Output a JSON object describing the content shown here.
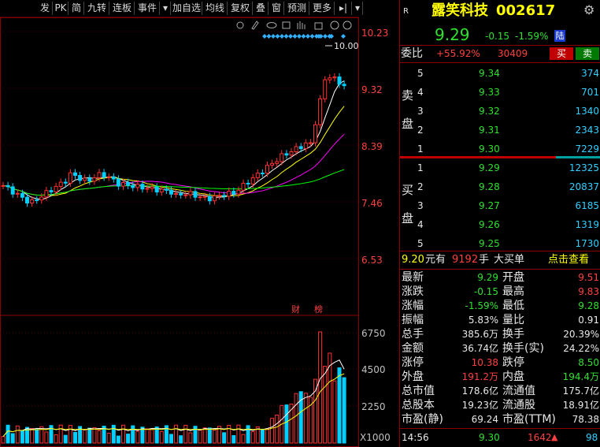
{
  "toolbar": {
    "items": [
      "发",
      "PK",
      "简",
      "九转",
      "连板",
      "事件",
      "▾",
      "加自选",
      "均线",
      "复权",
      "叠",
      "窗",
      "预测",
      "更多",
      "▸|",
      "▾"
    ]
  },
  "chart": {
    "price_ticks": [
      "10.23",
      "9.32",
      "8.39",
      "7.46",
      "6.53"
    ],
    "volume_ticks": [
      "6750",
      "4500",
      "2250"
    ],
    "volume_unit": "X1000",
    "high_label": "10.00",
    "event_tags": [
      "财",
      "榜"
    ]
  },
  "stock": {
    "market_badge": "R",
    "name": "露笑科技",
    "code": "002617",
    "price": "9.29",
    "change": "-0.15",
    "change_pct": "-1.59%",
    "exchange_badge": "陆"
  },
  "weibi": {
    "label": "委比",
    "pct": "+55.92%",
    "diff": "30409",
    "buy_btn": "买",
    "sell_btn": "卖"
  },
  "sell_label": [
    "卖",
    "盘"
  ],
  "buy_label": [
    "买",
    "盘"
  ],
  "sell_orders": [
    {
      "lvl": "5",
      "price": "9.34",
      "vol": "374"
    },
    {
      "lvl": "4",
      "price": "9.33",
      "vol": "701"
    },
    {
      "lvl": "3",
      "price": "9.32",
      "vol": "1340"
    },
    {
      "lvl": "2",
      "price": "9.31",
      "vol": "2343"
    },
    {
      "lvl": "1",
      "price": "9.30",
      "vol": "7229"
    }
  ],
  "buy_orders": [
    {
      "lvl": "1",
      "price": "9.29",
      "vol": "12325"
    },
    {
      "lvl": "2",
      "price": "9.28",
      "vol": "20837"
    },
    {
      "lvl": "3",
      "price": "9.27",
      "vol": "6185"
    },
    {
      "lvl": "4",
      "price": "9.26",
      "vol": "1319"
    },
    {
      "lvl": "5",
      "price": "9.25",
      "vol": "1730"
    }
  ],
  "big_order": {
    "price": "9.20",
    "unit1": "元有",
    "qty": "9192",
    "unit2": "手",
    "label": "大买单",
    "link": "点击查看"
  },
  "stats": [
    {
      "l1": "最新",
      "v1": "9.29",
      "c1": "green",
      "l2": "开盘",
      "v2": "9.51",
      "c2": "red"
    },
    {
      "l1": "涨跌",
      "v1": "-0.15",
      "c1": "green",
      "l2": "最高",
      "v2": "9.83",
      "c2": "red"
    },
    {
      "l1": "涨幅",
      "v1": "-1.59%",
      "c1": "green",
      "l2": "最低",
      "v2": "9.28",
      "c2": "green"
    },
    {
      "l1": "振幅",
      "v1": "5.83%",
      "c1": "white",
      "l2": "量比",
      "v2": "0.91",
      "c2": "white"
    },
    {
      "l1": "总手",
      "v1": "385.6万",
      "c1": "white",
      "l2": "换手",
      "v2": "20.39%",
      "c2": "white"
    },
    {
      "l1": "金额",
      "v1": "36.74亿",
      "c1": "white",
      "l2": "换手(实)",
      "v2": "24.22%",
      "c2": "white"
    },
    {
      "l1": "涨停",
      "v1": "10.38",
      "c1": "red",
      "l2": "跌停",
      "v2": "8.50",
      "c2": "green"
    },
    {
      "l1": "外盘",
      "v1": "191.2万",
      "c1": "red",
      "l2": "内盘",
      "v2": "194.4万",
      "c2": "green"
    },
    {
      "l1": "总市值",
      "v1": "178.6亿",
      "c1": "white",
      "l2": "流通值",
      "v2": "175.7亿",
      "c2": "white"
    },
    {
      "l1": "总股本",
      "v1": "19.23亿",
      "c1": "white",
      "l2": "流通股",
      "v2": "18.91亿",
      "c2": "white"
    },
    {
      "l1": "市盈(静)",
      "v1": "69.24",
      "c1": "white",
      "l2": "市盈(TTM)",
      "v2": "78.38",
      "c2": "white"
    }
  ],
  "tick": {
    "time": "14:56",
    "price": "9.30",
    "vol": "1642",
    "count": "98"
  },
  "colors": {
    "up": "#ff3030",
    "down": "#00d0ff",
    "frame": "#8a0000",
    "yellow": "#ffff00"
  }
}
